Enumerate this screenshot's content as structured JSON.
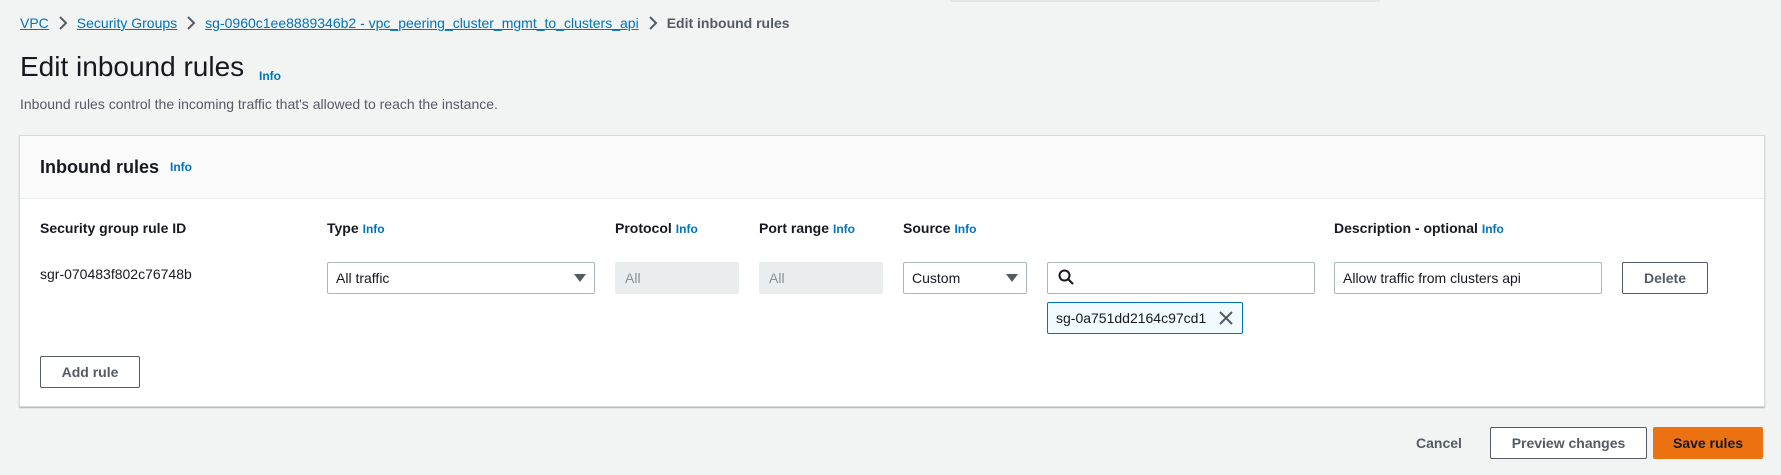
{
  "breadcrumb": {
    "items": [
      "VPC",
      "Security Groups",
      "sg-0960c1ee8889346b2 - vpc_peering_cluster_mgmt_to_clusters_api"
    ],
    "current": "Edit inbound rules"
  },
  "page": {
    "title": "Edit inbound rules",
    "info": "Info",
    "description": "Inbound rules control the incoming traffic that's allowed to reach the instance."
  },
  "inbound_rules": {
    "title": "Inbound rules",
    "info": "Info",
    "columns": {
      "rule_id": "Security group rule ID",
      "type": "Type",
      "protocol": "Protocol",
      "port_range": "Port range",
      "source": "Source",
      "description": "Description - optional",
      "info": "Info"
    },
    "rows": [
      {
        "rule_id": "sgr-070483f802c76748b",
        "type": "All traffic",
        "protocol": "All",
        "port_range": "All",
        "source_type": "Custom",
        "source_search": "",
        "source_token": "sg-0a751dd2164c97cd1",
        "description": "Allow traffic from clusters api",
        "delete_label": "Delete"
      }
    ],
    "add_rule_label": "Add rule"
  },
  "footer": {
    "cancel": "Cancel",
    "preview": "Preview changes",
    "save": "Save rules"
  },
  "colors": {
    "link": "#0073bb",
    "primary": "#ec7211",
    "background": "#f2f3f3"
  }
}
